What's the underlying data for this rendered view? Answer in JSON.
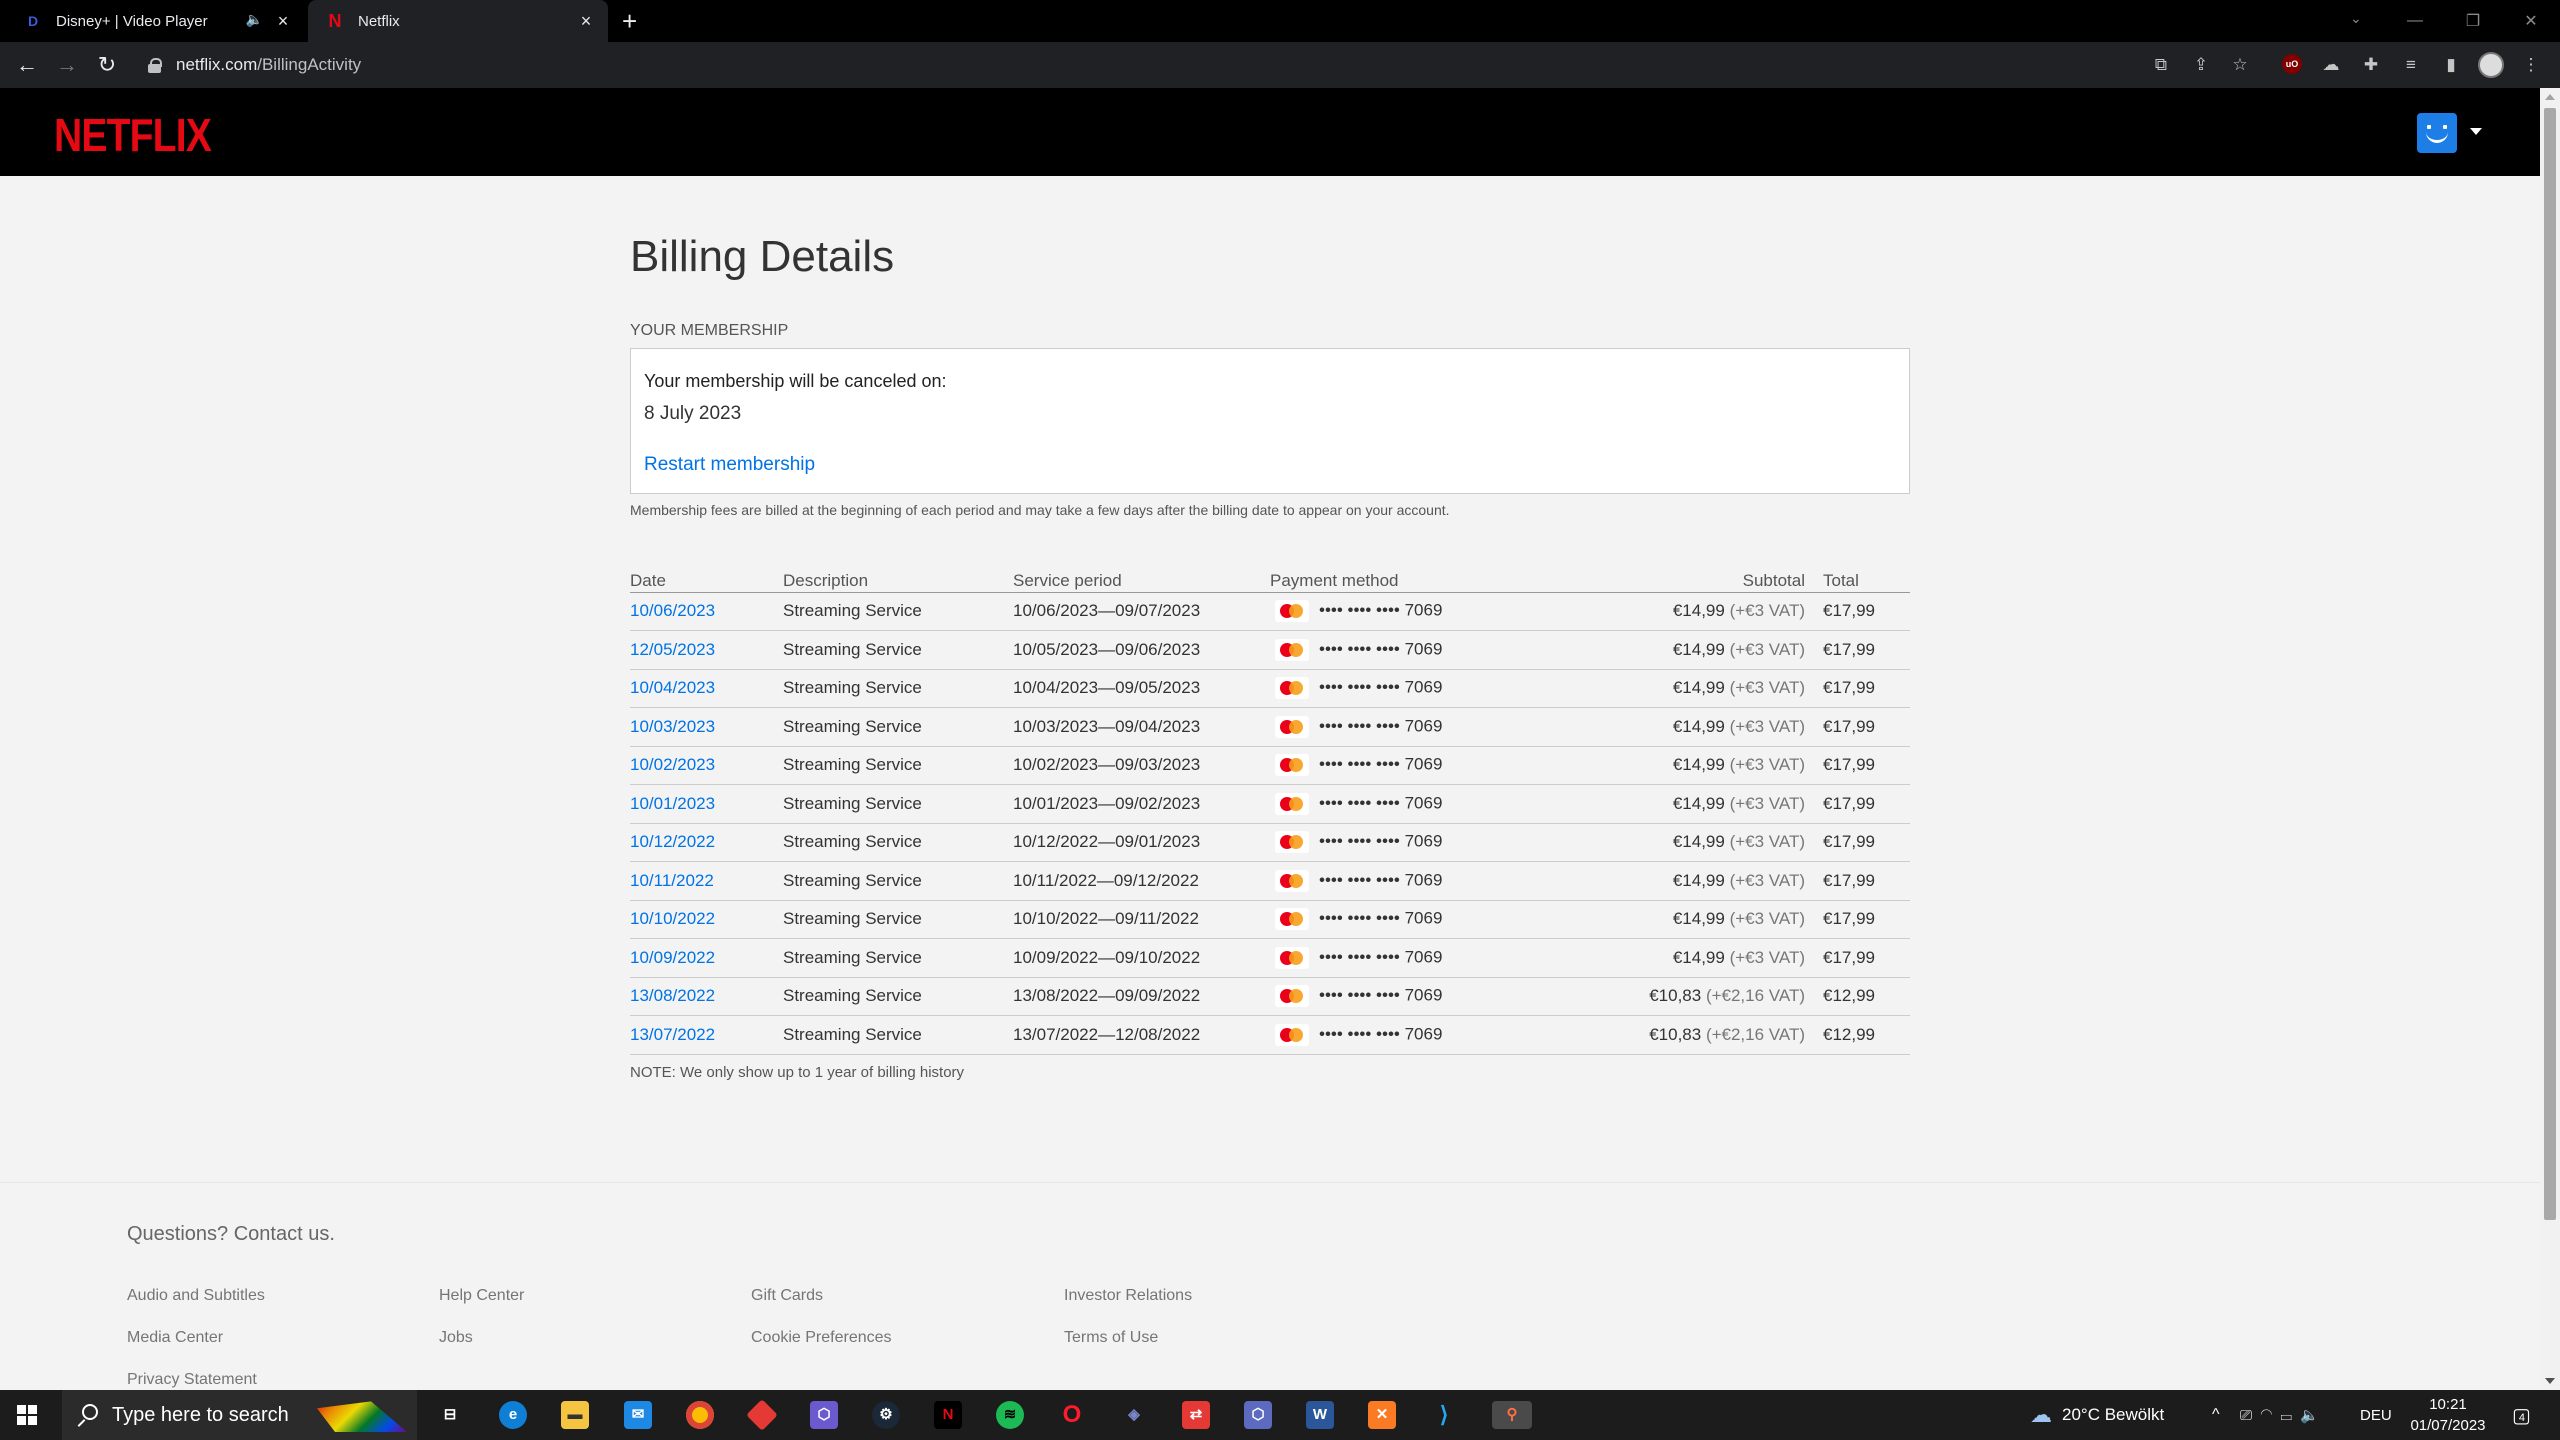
{
  "browser": {
    "tabs": [
      {
        "title": "Disney+ | Video Player",
        "active": false
      },
      {
        "title": "Netflix",
        "active": true
      }
    ],
    "url_host": "netflix.com",
    "url_path": "/BillingActivity"
  },
  "header": {
    "logo": "NETFLIX"
  },
  "page": {
    "title": "Billing Details",
    "membership_label": "YOUR MEMBERSHIP",
    "cancel_label": "Your membership will be canceled on:",
    "cancel_date": "8 July 2023",
    "restart_link": "Restart membership",
    "fee_note": "Membership fees are billed at the beginning of each period and may take a few days after the billing date to appear on your account.",
    "history_note": "NOTE: We only show up to 1 year of billing history"
  },
  "table": {
    "headers": [
      "Date",
      "Description",
      "Service period",
      "Payment method",
      "Subtotal",
      "Total"
    ],
    "rows": [
      {
        "date": "10/06/2023",
        "desc": "Streaming Service",
        "period": "10/06/2023—09/07/2023",
        "card": "•••• •••• •••• 7069",
        "subtotal": "€14,99",
        "vat": "(+€3 VAT)",
        "total": "€17,99"
      },
      {
        "date": "12/05/2023",
        "desc": "Streaming Service",
        "period": "10/05/2023—09/06/2023",
        "card": "•••• •••• •••• 7069",
        "subtotal": "€14,99",
        "vat": "(+€3 VAT)",
        "total": "€17,99"
      },
      {
        "date": "10/04/2023",
        "desc": "Streaming Service",
        "period": "10/04/2023—09/05/2023",
        "card": "•••• •••• •••• 7069",
        "subtotal": "€14,99",
        "vat": "(+€3 VAT)",
        "total": "€17,99"
      },
      {
        "date": "10/03/2023",
        "desc": "Streaming Service",
        "period": "10/03/2023—09/04/2023",
        "card": "•••• •••• •••• 7069",
        "subtotal": "€14,99",
        "vat": "(+€3 VAT)",
        "total": "€17,99"
      },
      {
        "date": "10/02/2023",
        "desc": "Streaming Service",
        "period": "10/02/2023—09/03/2023",
        "card": "•••• •••• •••• 7069",
        "subtotal": "€14,99",
        "vat": "(+€3 VAT)",
        "total": "€17,99"
      },
      {
        "date": "10/01/2023",
        "desc": "Streaming Service",
        "period": "10/01/2023—09/02/2023",
        "card": "•••• •••• •••• 7069",
        "subtotal": "€14,99",
        "vat": "(+€3 VAT)",
        "total": "€17,99"
      },
      {
        "date": "10/12/2022",
        "desc": "Streaming Service",
        "period": "10/12/2022—09/01/2023",
        "card": "•••• •••• •••• 7069",
        "subtotal": "€14,99",
        "vat": "(+€3 VAT)",
        "total": "€17,99"
      },
      {
        "date": "10/11/2022",
        "desc": "Streaming Service",
        "period": "10/11/2022—09/12/2022",
        "card": "•••• •••• •••• 7069",
        "subtotal": "€14,99",
        "vat": "(+€3 VAT)",
        "total": "€17,99"
      },
      {
        "date": "10/10/2022",
        "desc": "Streaming Service",
        "period": "10/10/2022—09/11/2022",
        "card": "•••• •••• •••• 7069",
        "subtotal": "€14,99",
        "vat": "(+€3 VAT)",
        "total": "€17,99"
      },
      {
        "date": "10/09/2022",
        "desc": "Streaming Service",
        "period": "10/09/2022—09/10/2022",
        "card": "•••• •••• •••• 7069",
        "subtotal": "€14,99",
        "vat": "(+€3 VAT)",
        "total": "€17,99"
      },
      {
        "date": "13/08/2022",
        "desc": "Streaming Service",
        "period": "13/08/2022—09/09/2022",
        "card": "•••• •••• •••• 7069",
        "subtotal": "€10,83",
        "vat": "(+€2,16 VAT)",
        "total": "€12,99"
      },
      {
        "date": "13/07/2022",
        "desc": "Streaming Service",
        "period": "13/07/2022—12/08/2022",
        "card": "•••• •••• •••• 7069",
        "subtotal": "€10,83",
        "vat": "(+€2,16 VAT)",
        "total": "€12,99"
      }
    ]
  },
  "footer": {
    "contact": "Questions? Contact us.",
    "links": [
      "Audio and Subtitles",
      "Help Center",
      "Gift Cards",
      "Investor Relations",
      "Media Center",
      "Jobs",
      "Cookie Preferences",
      "Terms of Use",
      "Privacy Statement"
    ]
  },
  "taskbar": {
    "search_placeholder": "Type here to search",
    "weather": "20°C  Bewölkt",
    "language": "DEU",
    "time": "10:21",
    "date": "01/07/2023",
    "notification_count": "4"
  },
  "colors": {
    "netflix_red": "#e50914",
    "link_blue": "#0073e6"
  }
}
